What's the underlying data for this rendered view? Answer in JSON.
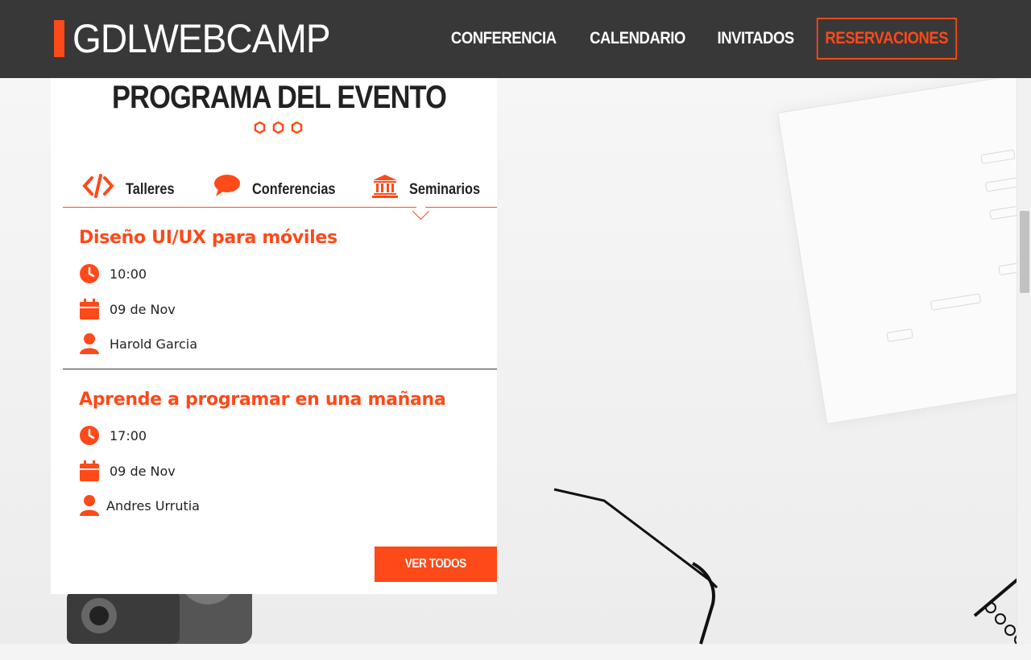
{
  "header": {
    "logo": "GDLWEBCAMP",
    "nav": [
      {
        "label": "CONFERENCIA"
      },
      {
        "label": "CALENDARIO"
      },
      {
        "label": "INVITADOS"
      },
      {
        "label": "RESERVACIONES"
      }
    ]
  },
  "program": {
    "title": "PROGRAMA DEL EVENTO",
    "tabs": [
      {
        "label": "Talleres",
        "icon": "code-icon"
      },
      {
        "label": "Conferencias",
        "icon": "comment-icon"
      },
      {
        "label": "Seminarios",
        "icon": "university-icon"
      }
    ],
    "active_tab": "Seminarios",
    "events": [
      {
        "title": "Diseño UI/UX para móviles",
        "time": "10:00",
        "date": "09 de Nov",
        "speaker": "Harold Garcia"
      },
      {
        "title": "Aprende a programar en una mañana",
        "time": "17:00",
        "date": "09 de Nov",
        "speaker": "Andres Urrutia"
      }
    ],
    "button": "VER TODOS"
  },
  "colors": {
    "accent": "#fe4918",
    "header_bg": "#383838",
    "text": "#222222"
  }
}
